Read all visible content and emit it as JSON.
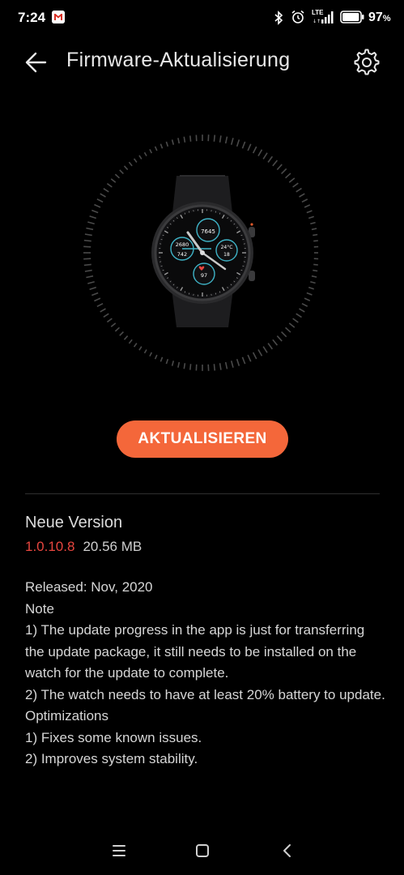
{
  "status_bar": {
    "time": "7:24",
    "network_label": "LTE",
    "battery_percent": "97",
    "battery_percent_suffix": "%",
    "battery_level": 0.97,
    "icons": [
      "gmail-icon",
      "bluetooth-icon",
      "alarm-icon",
      "signal-icon",
      "battery-icon"
    ]
  },
  "header": {
    "title": "Firmware-Aktualisierung",
    "back_icon": "back-arrow-icon",
    "settings_icon": "gear-icon"
  },
  "watch": {
    "metrics": [
      "7645",
      "2680",
      "742",
      "24°C",
      "18",
      "97"
    ],
    "accent_color": "#3fb4c8",
    "ring_color": "#4a4a4a"
  },
  "update_button": {
    "label": "AKTUALISIEREN",
    "color": "#f4673a"
  },
  "version": {
    "heading": "Neue Version",
    "number": "1.0.10.8",
    "size": "20.56 MB",
    "number_color": "#e8463f"
  },
  "release_notes": {
    "released": "Released: Nov, 2020",
    "note_heading": "Note",
    "note_1": "1) The update progress in the app is just for transferring the update package, it still needs to be installed on the watch for the update to complete.",
    "note_2": "2) The watch needs to have at least 20% battery to update.",
    "optimizations_heading": "Optimizations",
    "optimization_1": "1) Fixes some known issues.",
    "optimization_2": "2) Improves system stability."
  },
  "nav_bar": {
    "icons": [
      "menu-icon",
      "home-icon",
      "back-icon"
    ]
  }
}
